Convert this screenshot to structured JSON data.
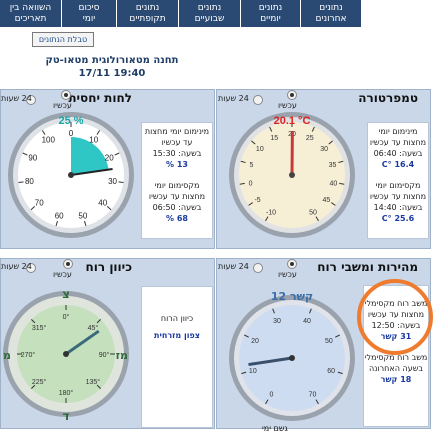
{
  "nav": {
    "tabs": [
      {
        "line1": "השוואה בין",
        "line2": "תאריכים"
      },
      {
        "line1": "סיכום",
        "line2": "יומי"
      },
      {
        "line1": "נתונים",
        "line2": "תקופתיים"
      },
      {
        "line1": "נתונים",
        "line2": "שבועיים"
      },
      {
        "line1": "נתונים",
        "line2": "יומיים"
      },
      {
        "line1": "נתונים",
        "line2": "אחרונים"
      }
    ]
  },
  "legend_button": "טבלת הנתונים",
  "station": {
    "name": "תחנה מטאורולוגית מטאו-טק",
    "datetime": "17/11 19:40"
  },
  "humidity": {
    "title": "לחות יחסית",
    "opt_now": "עכשיו",
    "opt_24": "24 שעות",
    "gauge_value": "25 %",
    "level_percent": 25,
    "min_label": "מינימום יומי מחצות עד עכשיו",
    "min_time_label": "בשעה: 15:30",
    "min_value": "13 %",
    "max_label": "מקסימום יומי מחצות עד עכשיו",
    "max_time_label": "בשעה: 06:50",
    "max_value": "68 %",
    "ticks": [
      "0",
      "10",
      "20",
      "30",
      "40",
      "50",
      "60",
      "70",
      "80",
      "90",
      "100"
    ]
  },
  "temperature": {
    "title": "טמפרטורה",
    "opt_now": "עכשיו",
    "opt_24": "24 שעות",
    "gauge_value": "20.1 °C",
    "reading_c": 20.1,
    "min_label": "מינימום יומי מחצות עד עכשיו",
    "min_time_label": "בשעה: 06:40",
    "min_value": "16.4 °C",
    "max_label": "מקסימום יומי מחצות עד עכשיו",
    "max_time_label": "בשעה: 14:40",
    "max_value": "25.6 °C",
    "ticks": [
      "-10",
      "-5",
      "0",
      "5",
      "10",
      "15",
      "20",
      "25",
      "30",
      "35",
      "40",
      "45",
      "50"
    ]
  },
  "wind_direction": {
    "title": "כיוון רוח",
    "opt_now": "עכשיו",
    "opt_24": "24 שעות",
    "dir_label": "כיוון הרוח",
    "dir_value": "צפון מזרחית",
    "bearing_deg": 55,
    "north": "צ",
    "south": "ד",
    "east": "מז",
    "west": "מ",
    "ticks": [
      "0°",
      "45°",
      "90°",
      "135°",
      "180°",
      "225°",
      "270°",
      "315°"
    ]
  },
  "wind_speed": {
    "title": "מהירות ומשבי רוח",
    "opt_now": "עכשיו",
    "opt_24": "24 שעות",
    "gauge_value": "12 קשר",
    "reading_knots": 12,
    "max_label": "משב רוח מקסימלי מחצות עד עכשיו",
    "max_time_label": "בשעה: 12:50",
    "max_value": "31 קשר",
    "hour_label": "משב רוח מקסימלי בשעה האחרונה",
    "hour_value": "18 קשר",
    "ticks": [
      "0",
      "10",
      "20",
      "30",
      "40",
      "50",
      "60",
      "70"
    ]
  },
  "bottom_text": "גשם ימי"
}
